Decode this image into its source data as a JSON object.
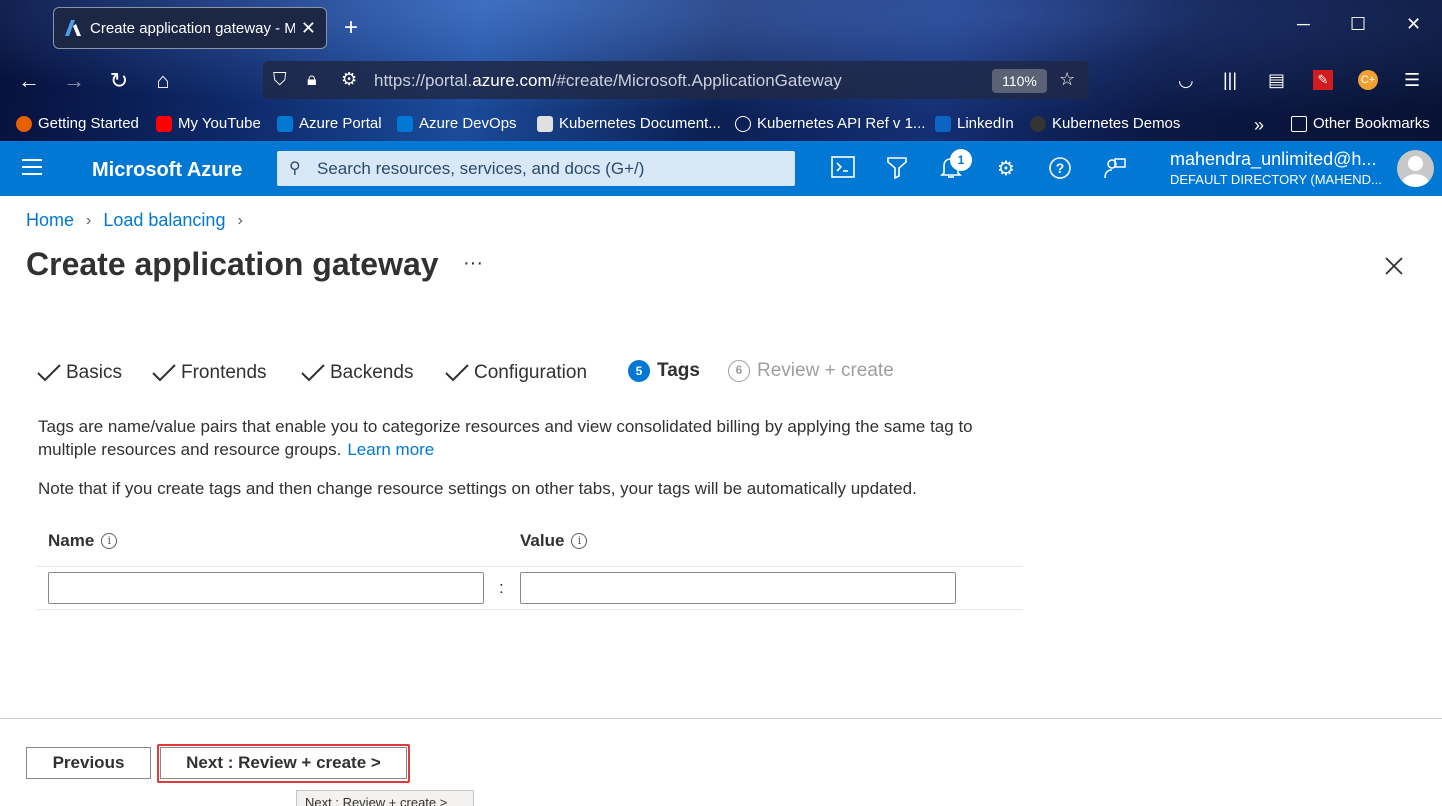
{
  "browser": {
    "tab_title": "Create application gateway - Microsoft Azure",
    "new_tab_label": "+",
    "url_prefix": "https://portal.",
    "url_domain": "azure.com",
    "url_suffix": "/#create/Microsoft.ApplicationGateway",
    "zoom": "110%",
    "bookmarks": [
      {
        "label": "Getting Started",
        "color": "#e66000"
      },
      {
        "label": "My YouTube",
        "color": "#ff0000"
      },
      {
        "label": "Azure Portal",
        "color": "#0078d4"
      },
      {
        "label": "Azure DevOps",
        "color": "#0078d4"
      },
      {
        "label": "Kubernetes Document...",
        "color": "#e0e0e0"
      },
      {
        "label": "Kubernetes API Ref v 1...",
        "color": "#e0e0e0"
      },
      {
        "label": "LinkedIn",
        "color": "#0a66c2"
      },
      {
        "label": "Kubernetes Demos",
        "color": "#333333"
      }
    ],
    "other_bookmarks": "Other Bookmarks"
  },
  "azure_header": {
    "brand": "Microsoft Azure",
    "search_placeholder": "Search resources, services, and docs (G+/)",
    "notification_count": "1",
    "user_name": "mahendra_unlimited@h...",
    "user_directory": "DEFAULT DIRECTORY (MAHEND..."
  },
  "breadcrumb": {
    "home": "Home",
    "load_balancing": "Load balancing"
  },
  "page": {
    "title": "Create application gateway",
    "more": "···"
  },
  "steps": [
    {
      "label": "Basics",
      "state": "done"
    },
    {
      "label": "Frontends",
      "state": "done"
    },
    {
      "label": "Backends",
      "state": "done"
    },
    {
      "label": "Configuration",
      "state": "done"
    },
    {
      "number": "5",
      "label": "Tags",
      "state": "active"
    },
    {
      "number": "6",
      "label": "Review + create",
      "state": "disabled"
    }
  ],
  "tags": {
    "description": "Tags are name/value pairs that enable you to categorize resources and view consolidated billing by applying the same tag to multiple resources and resource groups.",
    "learn_more": "Learn more",
    "note": "Note that if you create tags and then change resource settings on other tabs, your tags will be automatically updated.",
    "name_header": "Name",
    "value_header": "Value",
    "info_glyph": "i",
    "separator": ":",
    "name_value": "",
    "value_value": ""
  },
  "footer": {
    "previous": "Previous",
    "next": "Next : Review + create >",
    "tooltip": "Next : Review + create >"
  },
  "colors": {
    "azure_blue": "#0078d4",
    "highlight_red": "#e03a3a"
  }
}
